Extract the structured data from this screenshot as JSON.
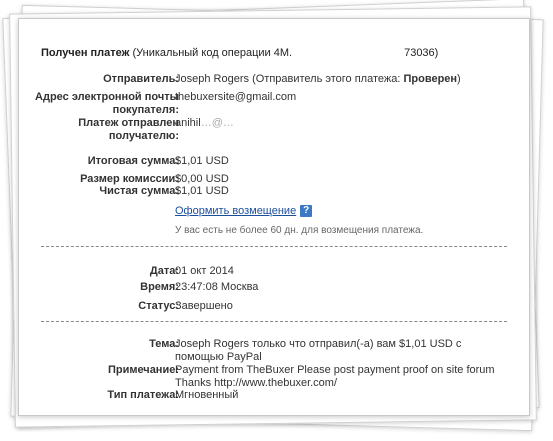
{
  "header": {
    "title_bold": "Получен платеж",
    "title_part1": "(Уникальный код операции 4M.",
    "title_part2": "73036)"
  },
  "sender": {
    "label": "Отправитель:",
    "name": "Joseph Rogers",
    "status_prefix": "(Отправитель этого платежа:",
    "status_value": "Проверен",
    "status_suffix": ")"
  },
  "buyer_email": {
    "label": "Адрес электронной почты покупателя:",
    "value": "thebuxersite@gmail.com"
  },
  "sent_to": {
    "label": "Платеж отправлен получателю:",
    "value": "anihil",
    "value_faded": "…@…"
  },
  "amounts": {
    "total_label": "Итоговая сумма:",
    "total_value": "$1,01 USD",
    "fee_label": "Размер комиссии:",
    "fee_value": "$0,00 USD",
    "net_label": "Чистая сумма:",
    "net_value": "$1,01 USD"
  },
  "refund": {
    "link": "Оформить возмещение",
    "help_icon": "?",
    "note": "У вас есть не более 60 дн. для возмещения платежа."
  },
  "details": {
    "date_label": "Дата:",
    "date_value": "01 окт 2014",
    "time_label": "Время:",
    "time_value": "23:47:08 Москва",
    "status_label": "Статус:",
    "status_value": "Завершено"
  },
  "message": {
    "subject_label": "Тема:",
    "subject_value": "Joseph Rogers только что отправил(-а) вам $1,01 USD с помощью PayPal",
    "note_label": "Примечание:",
    "note_value": "Payment from TheBuxer Please post payment proof on site forum Thanks http://www.thebuxer.com/",
    "type_label": "Тип платежа:",
    "type_value": "Мгновенный"
  }
}
